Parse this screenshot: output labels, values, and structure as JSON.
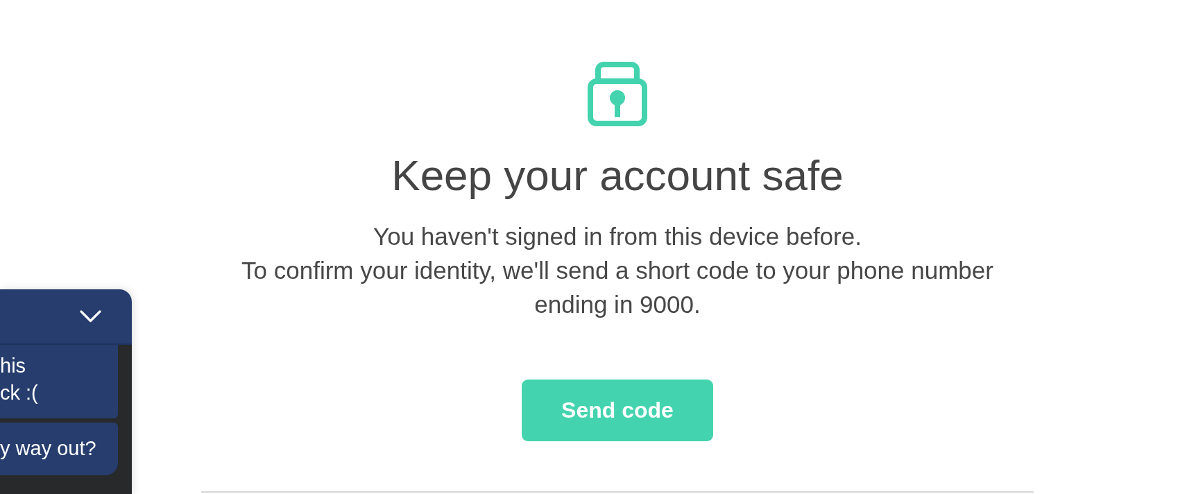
{
  "security_prompt": {
    "title": "Keep your account safe",
    "message": [
      "You haven't signed in from this device before.",
      "To confirm your identity, we'll send a short code to your phone number ending in 9000."
    ],
    "button": "Send code"
  },
  "chat_widget": {
    "messages": [
      {
        "lines": [
          "his",
          "ck :("
        ]
      },
      {
        "lines": [
          "y way out?"
        ]
      }
    ]
  }
}
